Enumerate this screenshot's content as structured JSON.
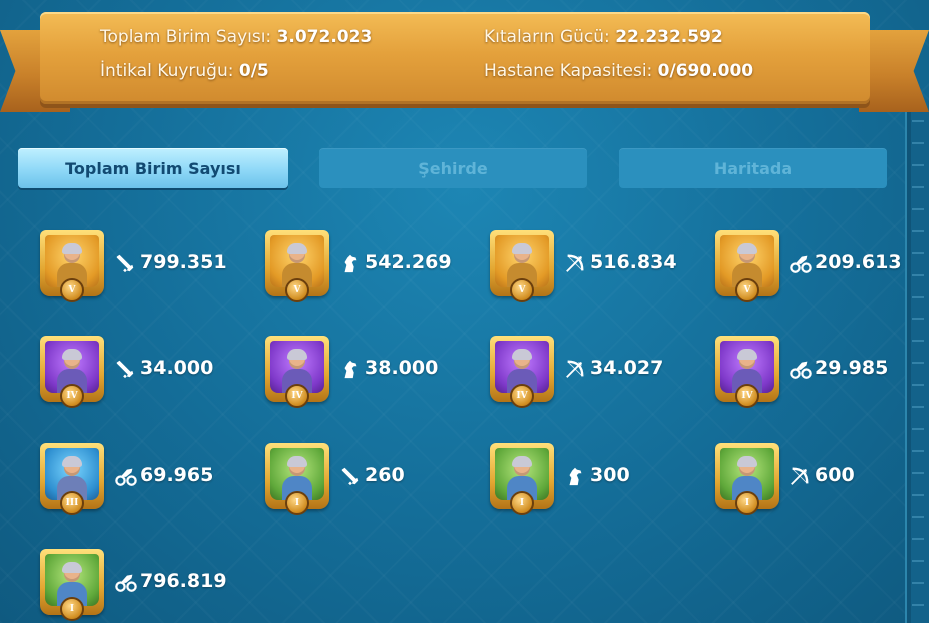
{
  "summary": {
    "total_units_label": "Toplam Birim Sayısı:",
    "total_units_value": "3.072.023",
    "march_queue_label": "İntikal Kuyruğu:",
    "march_queue_value": "0/5",
    "continent_power_label": "Kıtaların Gücü:",
    "continent_power_value": "22.232.592",
    "hospital_capacity_label": "Hastane Kapasitesi:",
    "hospital_capacity_value": "0/690.000"
  },
  "tabs": [
    {
      "label": "Toplam Birim Sayısı",
      "active": true
    },
    {
      "label": "Şehirde",
      "active": false
    },
    {
      "label": "Haritada",
      "active": false
    }
  ],
  "units": [
    {
      "type_icon": "infantry-icon",
      "tier": "V",
      "count": "799.351",
      "frame": "gold"
    },
    {
      "type_icon": "cavalry-icon",
      "tier": "V",
      "count": "542.269",
      "frame": "gold"
    },
    {
      "type_icon": "archer-icon",
      "tier": "V",
      "count": "516.834",
      "frame": "gold"
    },
    {
      "type_icon": "siege-icon",
      "tier": "V",
      "count": "209.613",
      "frame": "gold"
    },
    {
      "type_icon": "infantry-icon",
      "tier": "IV",
      "count": "34.000",
      "frame": "purple"
    },
    {
      "type_icon": "cavalry-icon",
      "tier": "IV",
      "count": "38.000",
      "frame": "purple"
    },
    {
      "type_icon": "archer-icon",
      "tier": "IV",
      "count": "34.027",
      "frame": "purple"
    },
    {
      "type_icon": "siege-icon",
      "tier": "IV",
      "count": "29.985",
      "frame": "purple"
    },
    {
      "type_icon": "siege-icon",
      "tier": "III",
      "count": "69.965",
      "frame": "blue"
    },
    {
      "type_icon": "infantry-icon",
      "tier": "I",
      "count": "260",
      "frame": "green"
    },
    {
      "type_icon": "cavalry-icon",
      "tier": "I",
      "count": "300",
      "frame": "green"
    },
    {
      "type_icon": "archer-icon",
      "tier": "I",
      "count": "600",
      "frame": "green"
    },
    {
      "type_icon": "siege-icon",
      "tier": "I",
      "count": "796.819",
      "frame": "green"
    }
  ]
}
